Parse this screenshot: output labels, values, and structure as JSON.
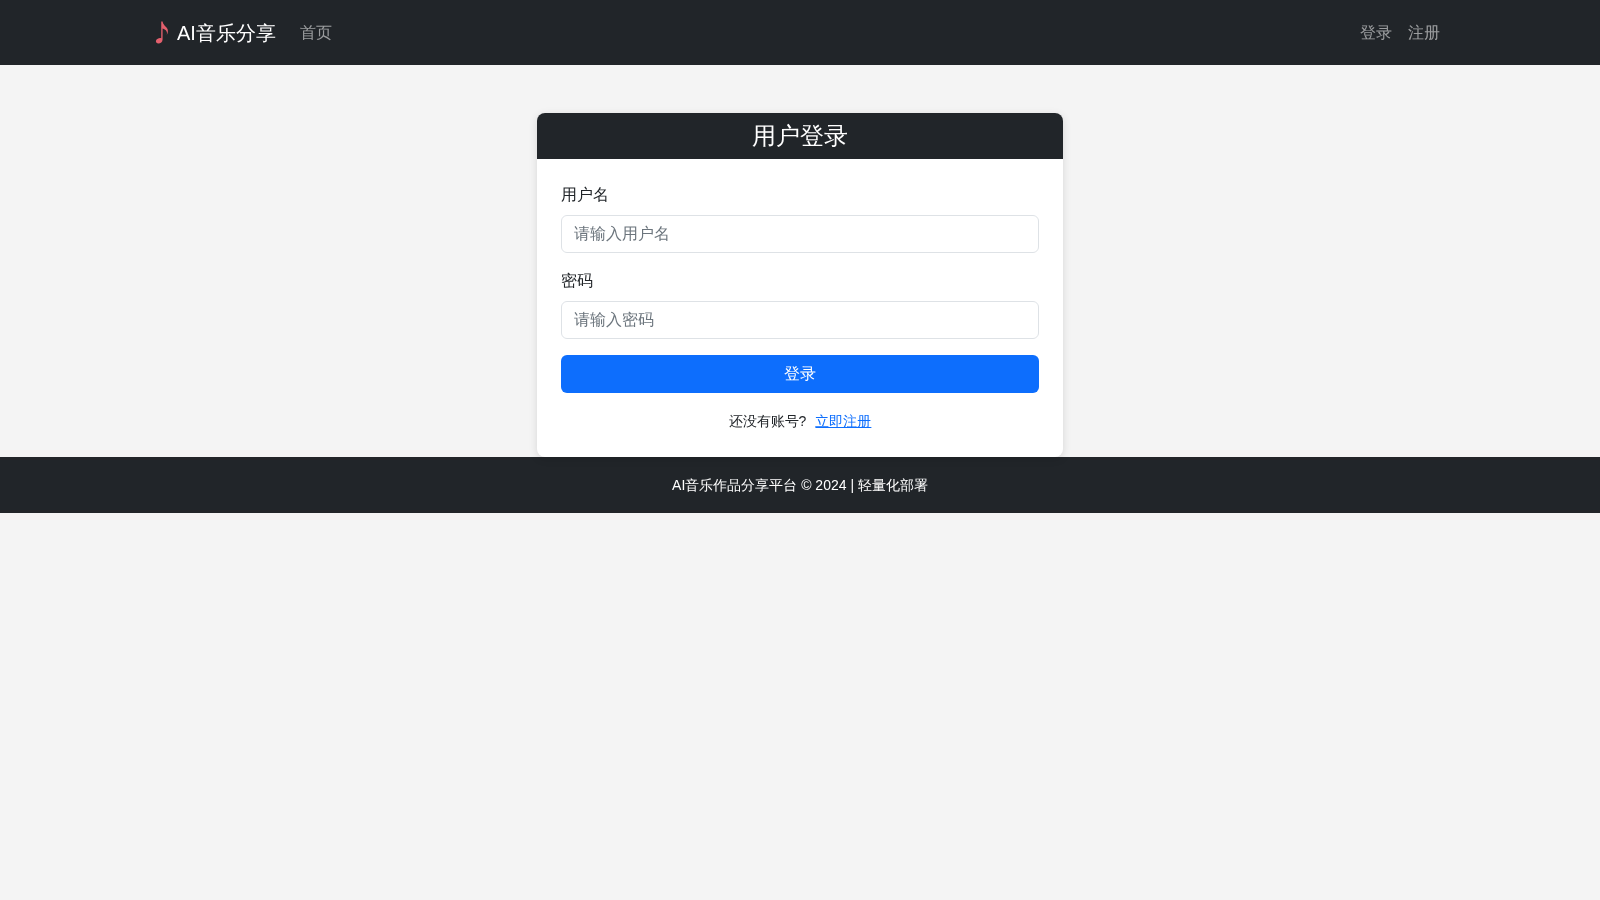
{
  "navbar": {
    "brand": "AI音乐分享",
    "links": [
      {
        "label": "首页"
      }
    ],
    "right_links": [
      {
        "label": "登录"
      },
      {
        "label": "注册"
      }
    ]
  },
  "login_card": {
    "title": "用户登录",
    "fields": [
      {
        "label": "用户名",
        "placeholder": "请输入用户名"
      },
      {
        "label": "密码",
        "placeholder": "请输入密码"
      }
    ],
    "submit": "登录",
    "register_prompt": {
      "text": "还没有账号?",
      "link": "立即注册"
    }
  },
  "footer": {
    "text": "AI音乐作品分享平台 © 2024 | 轻量化部署"
  }
}
